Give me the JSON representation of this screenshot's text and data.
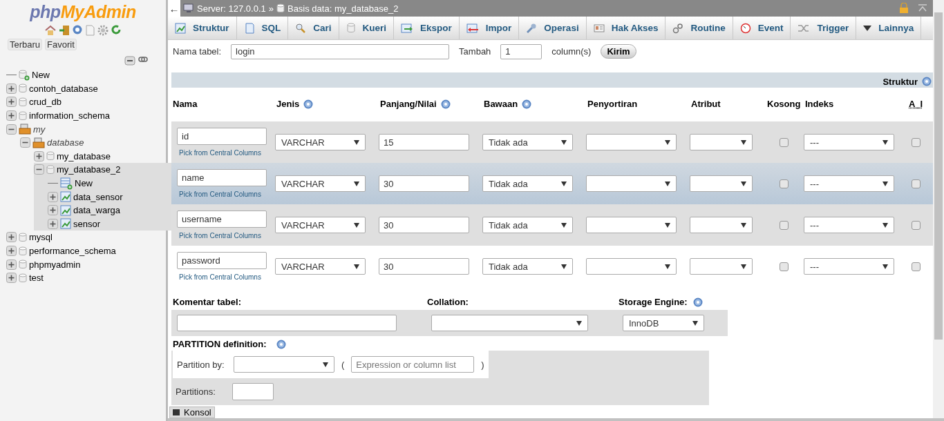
{
  "logo": {
    "first": "php",
    "second": "MyAdmin"
  },
  "sidebar": {
    "tabs": [
      "Terbaru",
      "Favorit"
    ],
    "tree": [
      {
        "label": "New",
        "kind": "new",
        "selected": false
      },
      {
        "label": "contoh_database",
        "kind": "db",
        "expanded": false,
        "selected": false
      },
      {
        "label": "crud_db",
        "kind": "db",
        "expanded": false,
        "selected": false
      },
      {
        "label": "information_schema",
        "kind": "db",
        "expanded": false,
        "selected": false
      },
      {
        "label": "my",
        "kind": "group",
        "expanded": true,
        "selected": false,
        "children": [
          {
            "label": "database",
            "kind": "group",
            "expanded": true,
            "selected": false,
            "children": [
              {
                "label": "my_database",
                "kind": "db",
                "expanded": false,
                "selected": false
              },
              {
                "label": "my_database_2",
                "kind": "db",
                "expanded": true,
                "selected": true,
                "children": [
                  {
                    "label": "New",
                    "kind": "new-table",
                    "selected": false
                  },
                  {
                    "label": "data_sensor",
                    "kind": "table",
                    "expanded": false,
                    "selected": false
                  },
                  {
                    "label": "data_warga",
                    "kind": "table",
                    "expanded": false,
                    "selected": false
                  },
                  {
                    "label": "sensor",
                    "kind": "table",
                    "expanded": false,
                    "selected": false
                  }
                ]
              }
            ]
          }
        ]
      },
      {
        "label": "mysql",
        "kind": "db",
        "expanded": false,
        "selected": false
      },
      {
        "label": "performance_schema",
        "kind": "db",
        "expanded": false,
        "selected": false
      },
      {
        "label": "phpmyadmin",
        "kind": "db",
        "expanded": false,
        "selected": false
      },
      {
        "label": "test",
        "kind": "db",
        "expanded": false,
        "selected": false
      }
    ]
  },
  "breadcrumb": {
    "back": "←",
    "server": "Server: 127.0.0.1",
    "separator": "»",
    "database": "Basis data: my_database_2"
  },
  "tabs": [
    {
      "label": "Struktur"
    },
    {
      "label": "SQL"
    },
    {
      "label": "Cari"
    },
    {
      "label": "Kueri"
    },
    {
      "label": "Ekspor"
    },
    {
      "label": "Impor"
    },
    {
      "label": "Operasi"
    },
    {
      "label": "Hak Akses"
    },
    {
      "label": "Routine"
    },
    {
      "label": "Event"
    },
    {
      "label": "Trigger"
    },
    {
      "label": "Lainnya"
    }
  ],
  "create_form": {
    "name_label": "Nama tabel:",
    "name_value": "login",
    "add_label": "Tambah",
    "add_value": "1",
    "add_unit": "column(s)",
    "submit": "Kirim"
  },
  "section_title": "Struktur",
  "columns": [
    {
      "label": "Nama",
      "help": false
    },
    {
      "label": "Jenis",
      "help": true
    },
    {
      "label": "Panjang/Nilai",
      "help": true
    },
    {
      "label": "Bawaan",
      "help": true
    },
    {
      "label": "Penyortiran",
      "help": false
    },
    {
      "label": "Atribut",
      "help": false
    },
    {
      "label": "Kosong",
      "help": false
    },
    {
      "label": "Indeks",
      "help": false
    },
    {
      "label": "A_I",
      "help": false
    }
  ],
  "rows": [
    {
      "name": "id",
      "hint": "Pick from Central Columns",
      "type": "VARCHAR",
      "length": "15",
      "default": "Tidak ada",
      "index": "---",
      "null": false,
      "ai": false,
      "highlighted": false
    },
    {
      "name": "name",
      "hint": "Pick from Central Columns",
      "type": "VARCHAR",
      "length": "30",
      "default": "Tidak ada",
      "index": "---",
      "null": false,
      "ai": false,
      "highlighted": true
    },
    {
      "name": "username",
      "hint": "Pick from Central Columns",
      "type": "VARCHAR",
      "length": "30",
      "default": "Tidak ada",
      "index": "---",
      "null": false,
      "ai": false,
      "highlighted": false
    },
    {
      "name": "password",
      "hint": "Pick from Central Columns",
      "type": "VARCHAR",
      "length": "30",
      "default": "Tidak ada",
      "index": "---",
      "null": false,
      "ai": false,
      "highlighted": false
    }
  ],
  "table_options": {
    "comment_label": "Komentar tabel:",
    "collation_label": "Collation:",
    "engine_label": "Storage Engine:",
    "engine_value": "InnoDB"
  },
  "partition": {
    "title": "PARTITION definition:",
    "by_label": "Partition by:",
    "open_paren": "(",
    "expr_placeholder": "Expression or column list",
    "close_paren": ")",
    "count_label": "Partitions:"
  },
  "console": {
    "label": "Konsol"
  }
}
